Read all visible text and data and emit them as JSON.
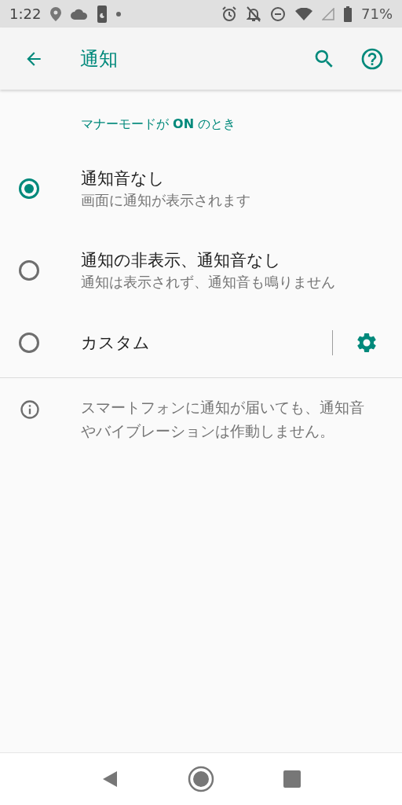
{
  "status_bar": {
    "time": "1:22",
    "battery": "71%"
  },
  "app_bar": {
    "title": "通知"
  },
  "section": {
    "header": "マナーモードが **ON** のとき"
  },
  "options": [
    {
      "title": "通知音なし",
      "subtitle": "画面に通知が表示されます",
      "selected": true,
      "has_settings": false
    },
    {
      "title": "通知の非表示、通知音なし",
      "subtitle": "通知は表示されず、通知音も鳴りません",
      "selected": false,
      "has_settings": false
    },
    {
      "title": "カスタム",
      "selected": false,
      "has_settings": true
    }
  ],
  "info": {
    "text": "スマートフォンに通知が届いても、通知音やバイブレーションは作動しません。"
  }
}
